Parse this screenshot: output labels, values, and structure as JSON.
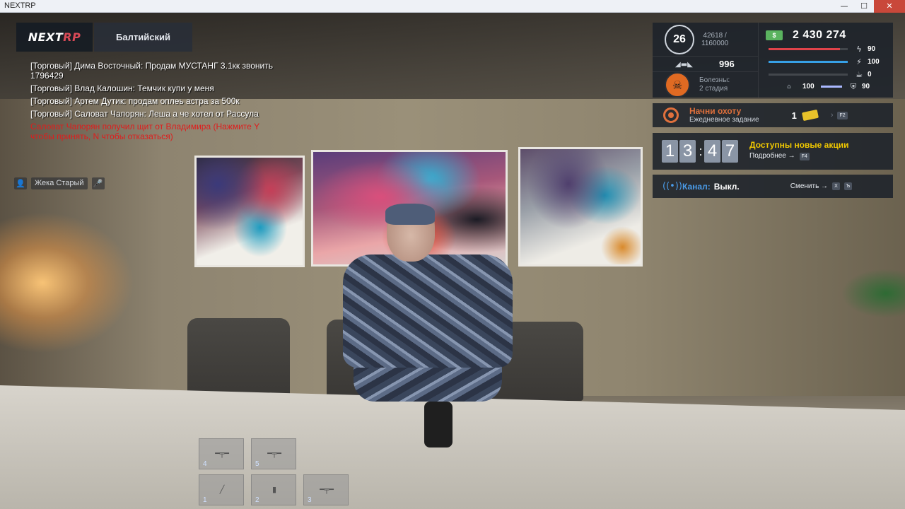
{
  "window": {
    "title": "NEXTRP",
    "min": "—",
    "max": "☐",
    "close": "✕"
  },
  "brand": {
    "logo_part1": "NEXT",
    "logo_part2": "RP",
    "server": "Балтийский"
  },
  "chat": [
    {
      "text": "[Торговый] Дима Восточный: Продам МУСТАНГ 3.1кк звонить 1796429",
      "color": "white"
    },
    {
      "text": "[Торговый] Влад Калошин: Темчик купи у меня",
      "color": "white"
    },
    {
      "text": "[Торговый] Артем Дутик: продам оплеь астра за 500к",
      "color": "white"
    },
    {
      "text": "[Торговый] Саловат Чапорян: Леша а че хотел от Рассула",
      "color": "white"
    },
    {
      "text": "Саловат Чапорян получил щит от Владимира (Нажмите Y чтобы принять, N чтобы отказаться)",
      "color": "red"
    }
  ],
  "voice": {
    "speaker": "Жека Старый",
    "prefix_icon": "👤",
    "mic_icon": "🎤"
  },
  "stats": {
    "level": "26",
    "exp_current": "42618 /",
    "exp_total": "1160000",
    "reputation": "996",
    "disease_label": "Болезны:",
    "disease_stage": "2 стадия",
    "money": "2 430 274",
    "money_icon_text": "$",
    "health": {
      "value": "90",
      "fill": 0.9,
      "color": "#e0434a",
      "icon": "ϟ"
    },
    "energy": {
      "value": "100",
      "fill": 1.0,
      "color": "#37a0e6",
      "icon": "⚡"
    },
    "hunger": {
      "value": "0",
      "fill": 0.0,
      "color": "#9aa3ad",
      "icon": "☕"
    },
    "stamina": {
      "value": "100",
      "icon": "⌂"
    },
    "armor": {
      "value": "90",
      "icon": "⛨"
    }
  },
  "quest": {
    "title": "Начни охоту",
    "subtitle": "Ежедневное задание",
    "count": "1",
    "key": "F2"
  },
  "promo": {
    "hours_d1": "1",
    "hours_d2": "3",
    "minutes_d1": "4",
    "minutes_d2": "7",
    "title": "Доступны новые акции",
    "more": "Подробнее →",
    "key": "F4"
  },
  "channel": {
    "label": "Канал:",
    "value": "Выкл.",
    "change": "Сменить →",
    "key1": "X",
    "key2": "Ъ"
  },
  "hotbar": [
    {
      "num": "4",
      "item": "rifle"
    },
    {
      "num": "5",
      "item": "rifle"
    },
    {
      "num": "1",
      "item": "baton"
    },
    {
      "num": "2",
      "item": "cup"
    },
    {
      "num": "3",
      "item": "rifle"
    }
  ]
}
